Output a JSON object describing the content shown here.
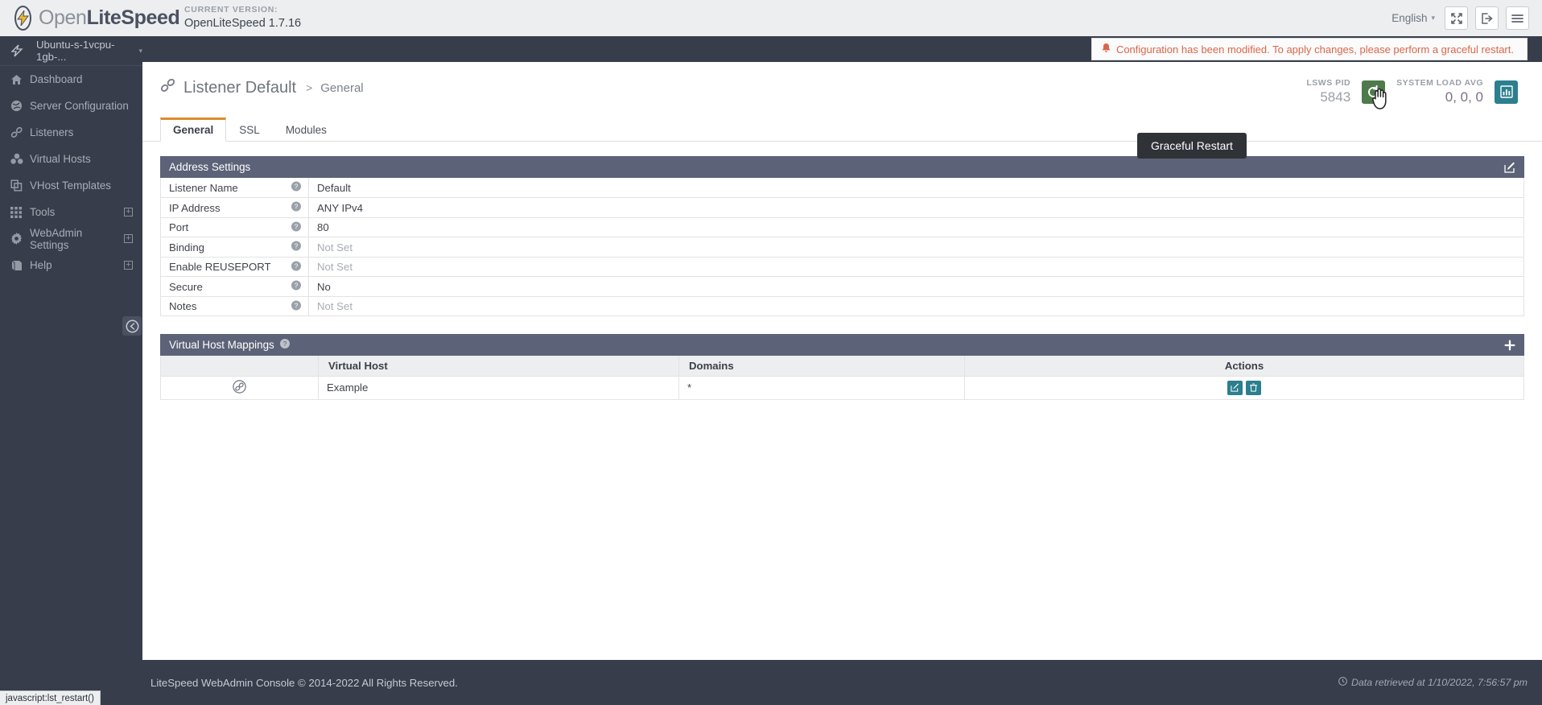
{
  "topbar": {
    "brand_open": "Open",
    "brand_lite": "LiteSpeed",
    "version_label": "CURRENT VERSION:",
    "version_value": "OpenLiteSpeed 1.7.16",
    "language": "English",
    "fullscreen_icon": "expand-icon",
    "logout_icon": "logout-icon",
    "menu_icon": "hamburger-menu-icon"
  },
  "sidebar": {
    "server_name": "Ubuntu-s-1vcpu-1gb-...",
    "items": [
      {
        "label": "Dashboard",
        "icon": "home-icon",
        "expandable": false
      },
      {
        "label": "Server Configuration",
        "icon": "globe-icon",
        "expandable": false
      },
      {
        "label": "Listeners",
        "icon": "link-icon",
        "expandable": false
      },
      {
        "label": "Virtual Hosts",
        "icon": "cubes-icon",
        "expandable": false
      },
      {
        "label": "VHost Templates",
        "icon": "copy-icon",
        "expandable": false
      },
      {
        "label": "Tools",
        "icon": "grid-icon",
        "expandable": true
      },
      {
        "label": "WebAdmin Settings",
        "icon": "gear-icon",
        "expandable": true
      },
      {
        "label": "Help",
        "icon": "book-icon",
        "expandable": true
      }
    ],
    "collapse_icon": "arrow-left-circle-icon"
  },
  "notification": {
    "icon": "bell-icon",
    "text": "Configuration has been modified. To apply changes, please perform a graceful restart."
  },
  "page": {
    "icon": "link-icon",
    "title": "Listener Default",
    "separator": ">",
    "subtitle": "General"
  },
  "stats": {
    "pid_label": "LSWS PID",
    "pid_value": "5843",
    "restart_icon": "refresh-icon",
    "load_label": "SYSTEM LOAD AVG",
    "load_value": "0, 0, 0",
    "chart_icon": "bar-chart-icon"
  },
  "tooltip": {
    "text": "Graceful Restart"
  },
  "tabs": [
    {
      "label": "General",
      "active": true
    },
    {
      "label": "SSL",
      "active": false
    },
    {
      "label": "Modules",
      "active": false
    }
  ],
  "address_settings": {
    "title": "Address Settings",
    "edit_icon": "edit-icon",
    "rows": [
      {
        "key": "Listener Name",
        "value": "Default",
        "notset": false
      },
      {
        "key": "IP Address",
        "value": "ANY IPv4",
        "notset": false
      },
      {
        "key": "Port",
        "value": "80",
        "notset": false
      },
      {
        "key": "Binding",
        "value": "Not Set",
        "notset": true
      },
      {
        "key": "Enable REUSEPORT",
        "value": "Not Set",
        "notset": true
      },
      {
        "key": "Secure",
        "value": "No",
        "notset": false
      },
      {
        "key": "Notes",
        "value": "Not Set",
        "notset": true
      }
    ]
  },
  "vhost_mappings": {
    "title": "Virtual Host Mappings",
    "help_icon": "question-circle-icon",
    "add_icon": "plus-icon",
    "columns": [
      "",
      "Virtual Host",
      "Domains",
      "Actions"
    ],
    "rows": [
      {
        "icon": "link-circle-icon",
        "virtual_host": "Example",
        "domains": "*",
        "edit_icon": "edit-icon",
        "delete_icon": "trash-icon"
      }
    ]
  },
  "footer": {
    "copyright": "LiteSpeed WebAdmin Console © 2014-2022 All Rights Reserved.",
    "clock_icon": "clock-icon",
    "retrieved": "Data retrieved at 1/10/2022, 7:56:57 pm"
  },
  "statusbar": {
    "text": "javascript:lst_restart()"
  },
  "colors": {
    "accent_orange": "#e08a2e",
    "sidebar": "#373d4b",
    "card_header": "#5c6277",
    "green": "#4f7a4b",
    "teal": "#2b7f8e",
    "warning": "#d9664a"
  }
}
